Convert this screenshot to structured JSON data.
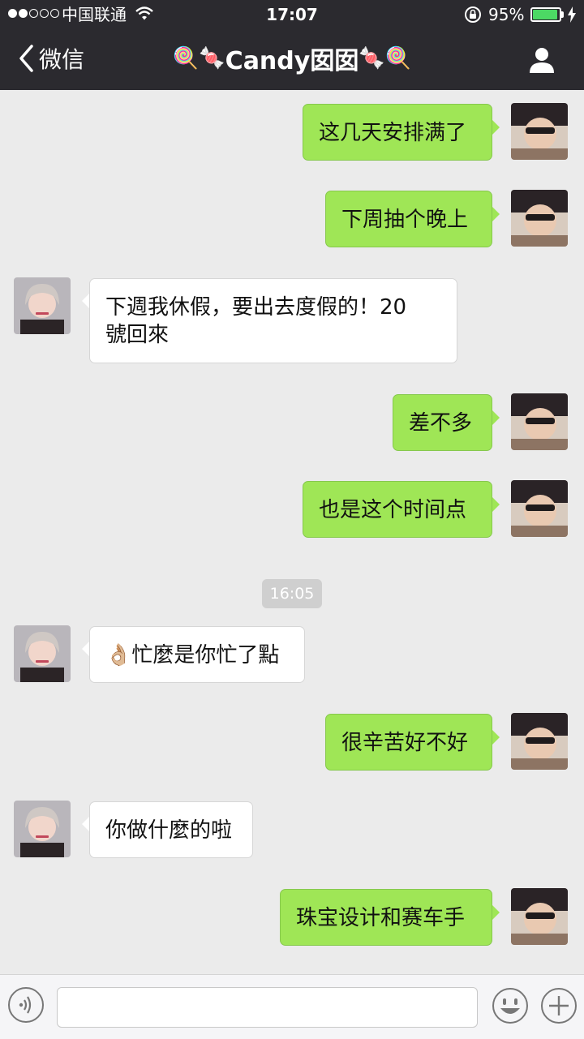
{
  "status_bar": {
    "carrier": "中国联通",
    "time": "17:07",
    "battery_percent": "95%",
    "battery_level": 0.95,
    "signal_bars": 2,
    "signal_total": 5
  },
  "nav": {
    "back_label": "微信",
    "title_prefix_emoji": "🍭🍬",
    "title_name": "Candy囡囡",
    "title_suffix_emoji": "🍬🍭"
  },
  "colors": {
    "nav_bg": "#2b2a2f",
    "chat_bg": "#ebebeb",
    "my_bubble": "#9fe656",
    "her_bubble": "#ffffff",
    "battery": "#4cd964"
  },
  "messages": [
    {
      "from": "me",
      "text": "这几天安排满了"
    },
    {
      "from": "me",
      "text": "下周抽个晚上"
    },
    {
      "from": "her",
      "lines": [
        "下週我休假，要出去度假的！20",
        "號回來"
      ]
    },
    {
      "from": "me",
      "text": "差不多"
    },
    {
      "from": "me",
      "text": "也是这个时间点"
    },
    {
      "type": "timestamp",
      "text": "16:05"
    },
    {
      "from": "her",
      "emoji": "👌🏼",
      "text": "忙麼是你忙了點"
    },
    {
      "from": "me",
      "text": "很辛苦好不好"
    },
    {
      "from": "her",
      "text": "你做什麼的啦"
    },
    {
      "from": "me",
      "text": "珠宝设计和赛车手"
    }
  ],
  "input_bar": {
    "text_value": "",
    "icons": [
      "voice-icon",
      "emoji-icon",
      "plus-icon"
    ]
  }
}
